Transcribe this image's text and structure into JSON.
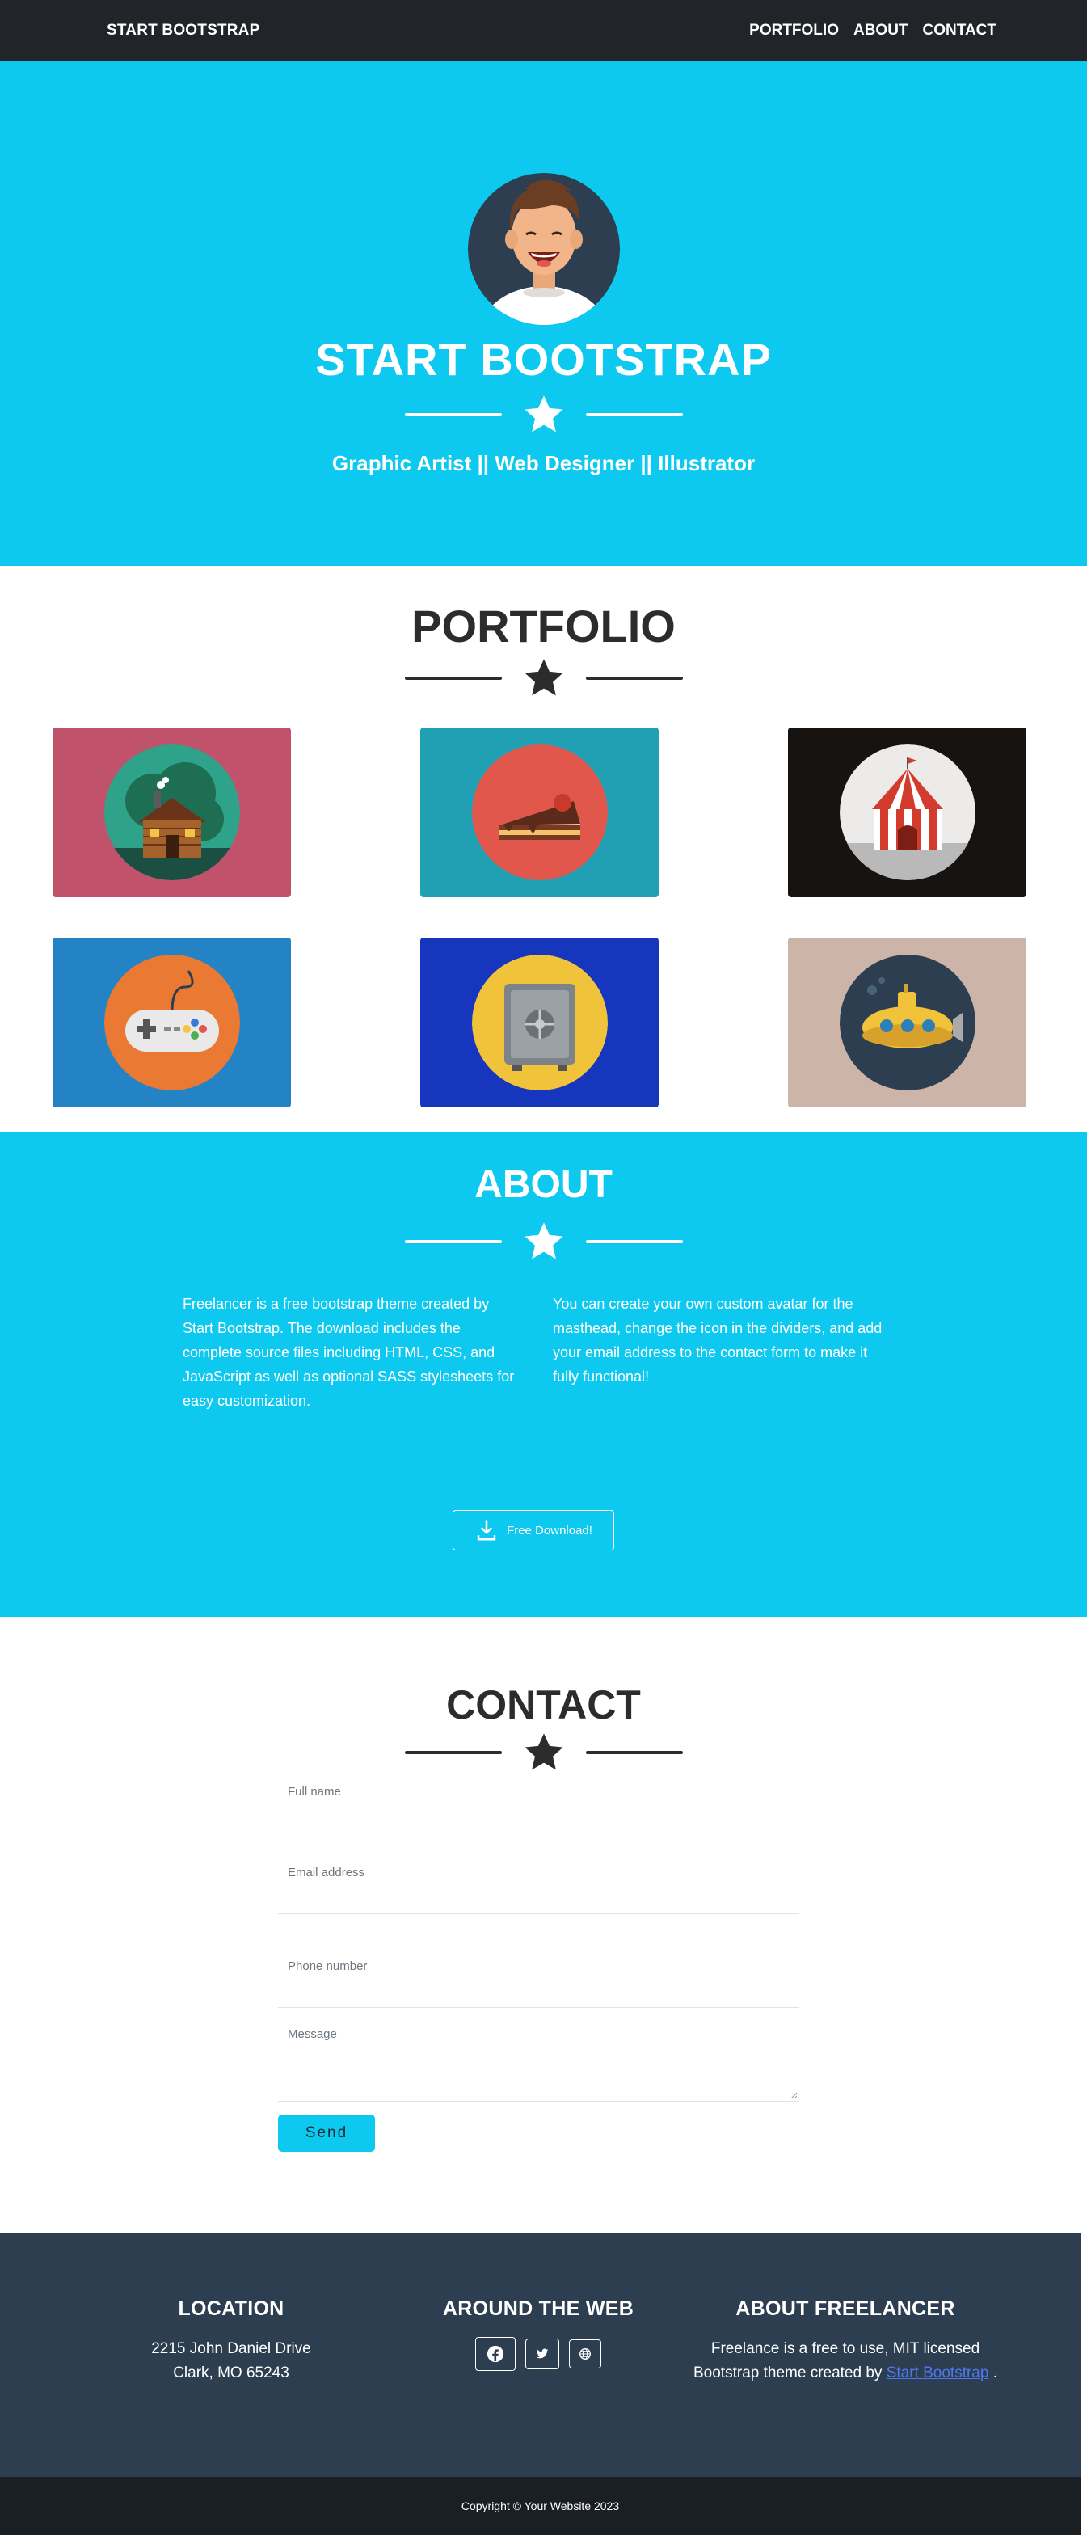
{
  "navbar": {
    "brand": "START BOOTSTRAP",
    "links": [
      "PORTFOLIO",
      "ABOUT",
      "CONTACT"
    ]
  },
  "masthead": {
    "title": "START BOOTSTRAP",
    "subtitle": "Graphic Artist || Web Designer || Illustrator"
  },
  "portfolio": {
    "heading": "PORTFOLIO",
    "items": [
      {
        "icon": "cabin-icon",
        "bg": "#c0536b"
      },
      {
        "icon": "cake-icon",
        "bg": "#21a0b4"
      },
      {
        "icon": "circus-tent-icon",
        "bg": "#171311"
      },
      {
        "icon": "game-controller-icon",
        "bg": "#2383c5"
      },
      {
        "icon": "safe-icon",
        "bg": "#1536bd"
      },
      {
        "icon": "submarine-icon",
        "bg": "#ccb4a8"
      }
    ]
  },
  "about": {
    "heading": "ABOUT",
    "left": "Freelancer is a free bootstrap theme created by Start Bootstrap. The download includes the complete source files including HTML, CSS, and JavaScript as well as optional SASS stylesheets for easy customization.",
    "right": "You can create your own custom avatar for the masthead, change the icon in the dividers, and add your email address to the contact form to make it fully functional!",
    "download_label": "Free Download!"
  },
  "contact": {
    "heading": "CONTACT",
    "fields": {
      "name": "Full name",
      "email": "Email address",
      "phone": "Phone number",
      "message": "Message"
    },
    "send_label": "Send"
  },
  "footer": {
    "location_title": "LOCATION",
    "location_line1": "2215 John Daniel Drive",
    "location_line2": "Clark, MO 65243",
    "web_title": "AROUND THE WEB",
    "social_icons": [
      "facebook-icon",
      "twitter-icon",
      "globe-icon"
    ],
    "about_title": "ABOUT FREELANCER",
    "about_text": "Freelance is a free to use, MIT licensed Bootstrap theme created by",
    "about_link": "Start Bootstrap",
    "about_end": ".",
    "copyright": "Copyright © Your Website 2023"
  },
  "colors": {
    "primary": "#0ec9ef",
    "dark": "#212529",
    "footer": "#2c3e50",
    "copyright_bg": "#1a1f24"
  }
}
